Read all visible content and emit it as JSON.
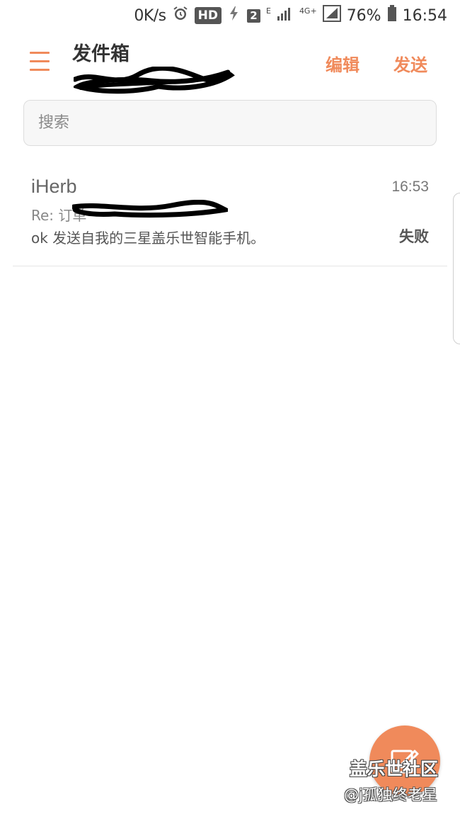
{
  "status_bar": {
    "net_speed": "0K/s",
    "hd_label": "HD",
    "sim_badge": "2",
    "network_small": "E",
    "network_4g": "4G+",
    "battery": "76%",
    "time": "16:54"
  },
  "header": {
    "title": "发件箱",
    "edit_label": "编辑",
    "send_label": "发送"
  },
  "search": {
    "placeholder": "搜索",
    "value": ""
  },
  "messages": [
    {
      "sender": "iHerb",
      "time": "16:53",
      "subject": "Re: 订单",
      "preview": "ok 发送自我的三星盖乐世智能手机。",
      "status": "失败"
    }
  ],
  "watermark": {
    "line1": "盖乐世社区",
    "line2": "@j孤独终老星"
  },
  "colors": {
    "accent": "#f08a5b"
  }
}
